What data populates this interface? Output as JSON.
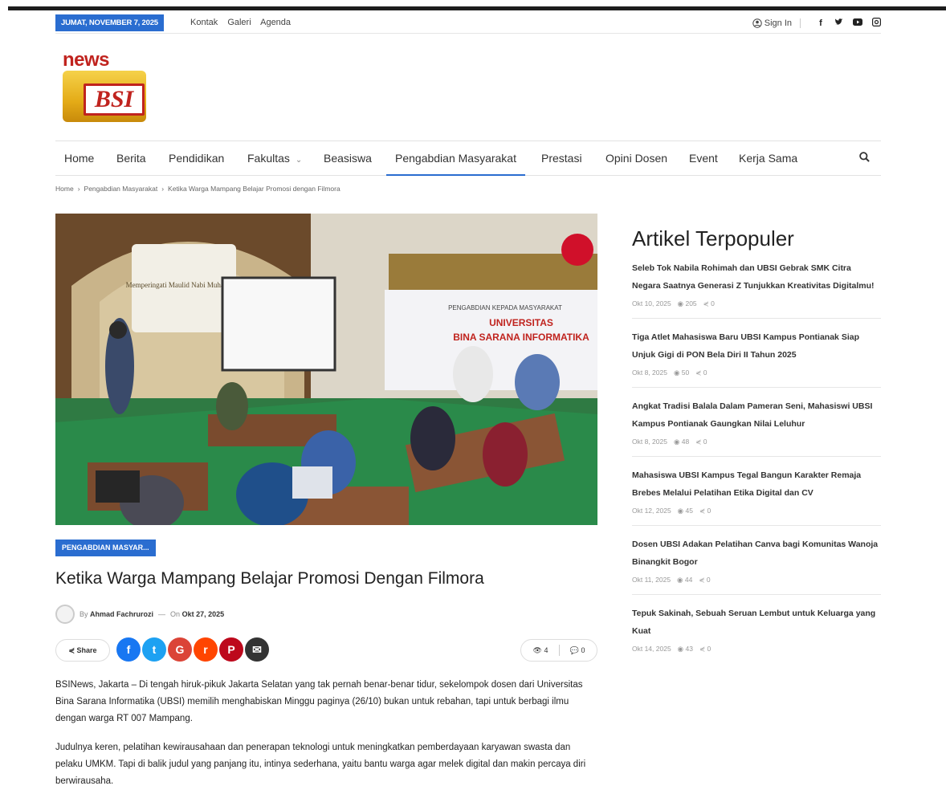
{
  "topbar": {
    "date": "JUMAT, NOVEMBER 7, 2025",
    "links": [
      "Kontak",
      "Galeri",
      "Agenda"
    ],
    "signin": "Sign In",
    "social_icons": [
      "facebook-icon",
      "twitter-icon",
      "youtube-icon",
      "instagram-icon"
    ]
  },
  "logo": {
    "top_text": "news",
    "box_text": "BSI"
  },
  "nav": {
    "items": [
      "Home",
      "Berita",
      "Pendidikan",
      "Fakultas",
      "Beasiswa",
      "Pengabdian Masyarakat",
      "Prestasi",
      "Opini Dosen",
      "Event",
      "Kerja Sama"
    ],
    "active": "Pengabdian Masyarakat",
    "search_icon": "search-icon"
  },
  "breadcrumb": [
    "Home",
    "Pengabdian Masyarakat",
    "Ketika Warga Mampang Belajar Promosi dengan Filmora"
  ],
  "hero": {
    "banner_left": "Memperingati Maulid Nabi Muhammad",
    "banner_right_small": "PENGABDIAN KEPADA MASYARAKAT",
    "banner_right_big1": "UNIVERSITAS",
    "banner_right_big2": "BINA SARANA INFORMATIKA"
  },
  "article": {
    "category": "PENGABDIAN MASYAR...",
    "title": "Ketika Warga Mampang Belajar Promosi Dengan Filmora",
    "author_prefix": "By",
    "author": "Ahmad Fachrurozi",
    "date_prefix": "On",
    "date": "Okt 27, 2025",
    "share_label": "Share",
    "views": "4",
    "comments": "0",
    "p1": "BSINews, Jakarta – Di tengah hiruk-pikuk Jakarta Selatan yang tak pernah benar-benar tidur, sekelompok dosen dari Universitas Bina Sarana Informatika (UBSI) memilih menghabiskan Minggu paginya (26/10) bukan untuk rebahan, tapi untuk berbagi ilmu dengan warga RT 007 Mampang.",
    "p2": "Judulnya keren, pelatihan kewirausahaan dan penerapan teknologi untuk meningkatkan pemberdayaan karyawan swasta dan pelaku UMKM. Tapi di balik judul yang panjang itu, intinya sederhana, yaitu bantu warga agar melek digital dan makin percaya diri berwirausaha."
  },
  "share_icons": [
    {
      "name": "facebook-share-icon",
      "glyph": "f",
      "color": "#1877f2"
    },
    {
      "name": "twitter-share-icon",
      "glyph": "t",
      "color": "#1da1f2"
    },
    {
      "name": "google-share-icon",
      "glyph": "G",
      "color": "#db4437"
    },
    {
      "name": "reddit-share-icon",
      "glyph": "r",
      "color": "#ff4500"
    },
    {
      "name": "pinterest-share-icon",
      "glyph": "P",
      "color": "#bd081c"
    },
    {
      "name": "email-share-icon",
      "glyph": "✉",
      "color": "#333333"
    }
  ],
  "sidebar": {
    "title": "Artikel Terpopuler",
    "items": [
      {
        "title": "Seleb Tok Nabila Rohimah dan UBSI Gebrak SMK Citra Negara Saatnya Generasi Z Tunjukkan Kreativitas Digitalmu!",
        "date": "Okt 10, 2025",
        "views": "205",
        "shares": "0"
      },
      {
        "title": "Tiga Atlet Mahasiswa Baru UBSI Kampus Pontianak Siap Unjuk Gigi di PON Bela Diri II Tahun 2025",
        "date": "Okt 8, 2025",
        "views": "50",
        "shares": "0"
      },
      {
        "title": "Angkat Tradisi Balala Dalam Pameran Seni, Mahasiswi UBSI Kampus Pontianak Gaungkan Nilai Leluhur",
        "date": "Okt 8, 2025",
        "views": "48",
        "shares": "0"
      },
      {
        "title": "Mahasiswa UBSI Kampus Tegal Bangun Karakter Remaja Brebes Melalui Pelatihan Etika Digital dan CV",
        "date": "Okt 12, 2025",
        "views": "45",
        "shares": "0"
      },
      {
        "title": "Dosen UBSI Adakan Pelatihan Canva bagi Komunitas Wanoja Binangkit Bogor",
        "date": "Okt 11, 2025",
        "views": "44",
        "shares": "0"
      },
      {
        "title": "Tepuk Sakinah, Sebuah Seruan Lembut untuk Keluarga yang Kuat",
        "date": "Okt 14, 2025",
        "views": "43",
        "shares": "0"
      }
    ]
  }
}
